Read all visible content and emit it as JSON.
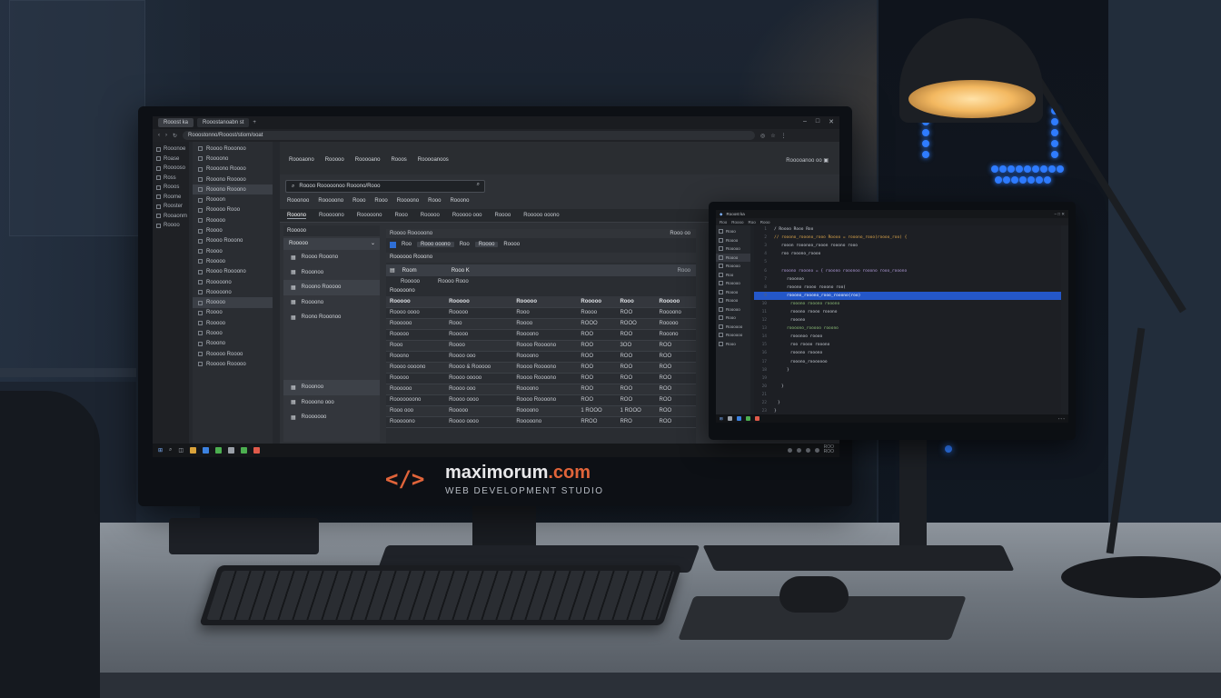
{
  "brand": {
    "icon": "</>",
    "name_main": "maximorum",
    "name_tld": ".com",
    "tagline": "WEB DEVELOPMENT STUDIO"
  },
  "colors": {
    "accent": "#e0643a",
    "highlight": "#2457c9",
    "led": "#2f7cff"
  },
  "main_screen": {
    "tabs": [
      "Rooost ka",
      "Rooostanoabn st"
    ],
    "window_controls": [
      "–",
      "□",
      "✕"
    ],
    "url": "Rooostonno/Rooost/stiom/ooat",
    "sidebar1": [
      "Rooonoe",
      "Roase",
      "Rooooso",
      "Ross",
      "Rooos",
      "Roome",
      "Rooster",
      "Rooaonm",
      "Roooo"
    ],
    "sidebar2": [
      "Roooo Rooonoo",
      "Roooono",
      "Roooono Roooo",
      "Rooono Rooooo",
      "Rooono Rooono",
      "Roooon",
      "Rooooo Rooo",
      "Rooooo",
      "Roooo",
      "Roooo Rooono",
      "Roooo",
      "Rooooo",
      "Roooo Roooono",
      "Rooooono",
      "Rooooono",
      "Rooooo",
      "Roooo",
      "Rooooo",
      "Roooo",
      "Rooono",
      "Rooooo Roooo",
      "Rooooo Rooooo"
    ],
    "top_links": [
      "Roooaono",
      "Rooooo",
      "Rooooano",
      "Rooos",
      "Rooooanoos"
    ],
    "top_right": "Rooooanoo oo",
    "search_placeholder": "Roooo Rooooonoo Rooono/Rooo",
    "sub_nav": [
      "Rooonoo",
      "Rooooono",
      "Rooo",
      "Rooo",
      "Roooono",
      "Rooo",
      "Rooono"
    ],
    "tabs2": [
      "Rooono",
      "Rooooono",
      "Rooooono",
      "Rooo",
      "Rooooo",
      "Rooooo ooo",
      "Roooo",
      "Rooooo ooono"
    ],
    "left_panel": {
      "header": "Rooooo",
      "dropdown": "Rooooo",
      "rows": [
        "Roooo Rooono",
        "Rooonoo",
        "Rooono Rooooo",
        "Roooono",
        "Roono Rooonoo"
      ],
      "bottom": [
        "Rooonoo",
        "Roooono ooo",
        "Rooooooo"
      ]
    },
    "right_panel": {
      "head": "Roooo Rooooono",
      "head_right": "Rooo oo",
      "tool": [
        "Roo",
        "Rooo ooono",
        "Roo",
        "Roooo",
        "Roooo"
      ],
      "section": "Roooooo Rooono",
      "selected": "Room",
      "selected_mid": "Rooo K",
      "selected_right": "Rooo",
      "row1": [
        "Rooooo",
        "Roooo Rooo"
      ],
      "section2": "Rooooono",
      "columns": [
        "Rooooo",
        "Rooooo",
        "Rooooo",
        "Rooooo",
        "Rooo",
        "Rooooo"
      ],
      "rows": [
        [
          "Roooo oooo",
          "Rooooo",
          "Rooo",
          "Roooo",
          "ROO",
          "Roooono"
        ],
        [
          "Roooooo",
          "Rooo",
          "Roooo",
          "ROOO",
          "ROOO",
          "Rooooo"
        ],
        [
          "Rooooo",
          "Rooooo",
          "Roooono",
          "ROO",
          "ROO",
          "Rooono"
        ],
        [
          "Rooo",
          "Roooo",
          "Roooo Roooono",
          "ROO",
          "3OO",
          "ROO"
        ],
        [
          "Rooono",
          "Roooo ooo",
          "Roooono",
          "ROO",
          "ROO",
          "ROO"
        ],
        [
          "Roooo oooono",
          "Roooo & Rooooo",
          "Roooo Roooono",
          "ROO",
          "ROO",
          "ROO"
        ],
        [
          "Rooooo",
          "Roooo ooooo",
          "Roooo Roooono",
          "ROO",
          "ROO",
          "ROO"
        ],
        [
          "Roooooo",
          "Roooo ooo",
          "Roooono",
          "ROO",
          "ROO",
          "ROO"
        ],
        [
          "Rooooooono",
          "Roooo oooo",
          "Roooo Roooono",
          "ROO",
          "ROO",
          "ROO"
        ],
        [
          "Rooo ooo",
          "Rooooo",
          "Roooono",
          "1 ROOO",
          "1 ROOO",
          "ROO"
        ],
        [
          "Rooooono",
          "Roooo oooo",
          "Rooooono",
          "RROO",
          "RRO",
          "ROO"
        ]
      ]
    },
    "tray": [
      "ROO",
      "ROO"
    ]
  },
  "second_screen": {
    "title": "Rooost ka",
    "menu": [
      "Roo",
      "Roooo",
      "Roo",
      "Rooo"
    ],
    "sidebar": [
      "Rooo",
      "Roooo",
      "Rooooo",
      "Roooo",
      "Rooooo",
      "Roo",
      "Rooooo",
      "Roooo",
      "Roooo",
      "Rooooo",
      "Rooo",
      "Roooooo",
      "Roooooo",
      "Rooo"
    ],
    "code": [
      {
        "t": "/ Roooo Rooo Roo",
        "c": "pl"
      },
      {
        "t": "// rooono_rooono_rooo Roooo = rooono_rooo(roooo_roo) {",
        "c": "kw"
      },
      {
        "t": "rooon rooonoo_rooon rooono rooo",
        "c": "pl"
      },
      {
        "t": "roo rooono_roooo",
        "c": "pl"
      },
      {
        "t": "",
        "c": "pl"
      },
      {
        "t": "rooono rooono = { rooono rooonoo rooono rooo_rooono",
        "c": "fn"
      },
      {
        "t": "rooonoo",
        "c": "pl"
      },
      {
        "t": "rooono roooo rooono roo(",
        "c": "pl"
      },
      {
        "t": "rooono_rooono_rooo_rooono(roo)",
        "c": "hl"
      },
      {
        "t": "rooono rooono rooono",
        "c": "st"
      },
      {
        "t": "rooono roooo rooono",
        "c": "pl"
      },
      {
        "t": "rooono",
        "c": "pl"
      },
      {
        "t": "roooono_rooooo rooono",
        "c": "st"
      },
      {
        "t": "rooonoo roooo",
        "c": "pl"
      },
      {
        "t": "roo roooo rooono",
        "c": "pl"
      },
      {
        "t": "rooono rooono",
        "c": "pl"
      },
      {
        "t": "rooono_rooooooo",
        "c": "pl"
      },
      {
        "t": "}",
        "c": "pl"
      },
      {
        "t": "",
        "c": "pl"
      },
      {
        "t": "}",
        "c": "pl"
      },
      {
        "t": "",
        "c": "pl"
      },
      {
        "t": "}",
        "c": "pl"
      },
      {
        "t": "}",
        "c": "pl"
      }
    ]
  }
}
